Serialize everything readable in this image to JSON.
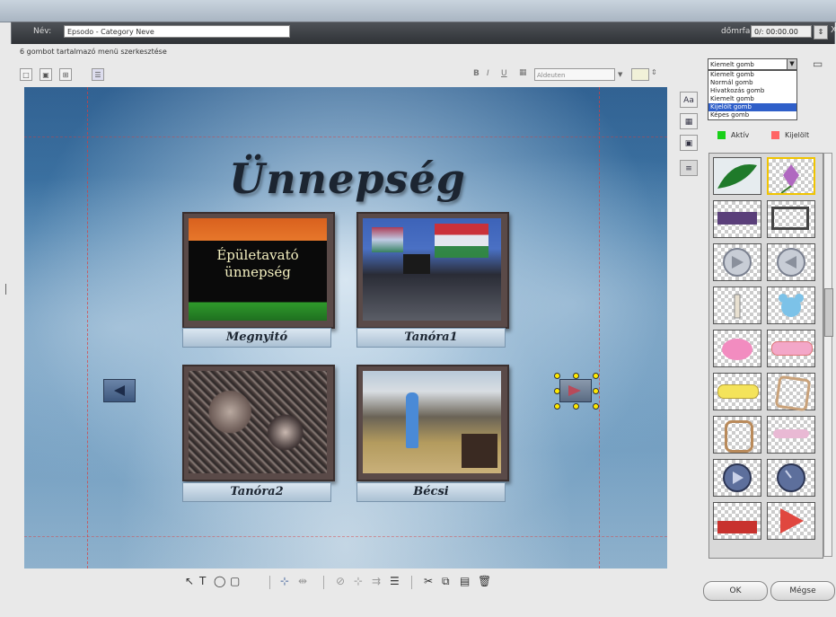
{
  "header": {
    "name_label": "Név:",
    "name_value": "Epsodo - Category Neve",
    "display_label": "dőmrfam",
    "display_value": "0/: 00:00.00",
    "close_glyph": "X"
  },
  "status": "6 gombot tartalmazó menü szerkesztése",
  "toolbar": {
    "font_value": "Aldeuten",
    "bold": "B",
    "italic": "I",
    "underline": "U"
  },
  "canvas": {
    "title": "Ünnepség",
    "thumbs": [
      {
        "caption": "Megnyitó",
        "img_text": "Épületavató ünnepség"
      },
      {
        "caption": "Tanóra1",
        "img_text": ""
      },
      {
        "caption": "Tanóra2",
        "img_text": ""
      },
      {
        "caption": "Bécsi",
        "img_text": ""
      }
    ]
  },
  "bottom_toolbar": {
    "pointer": "↖",
    "text": "T",
    "ellipse": "◯",
    "rect": "▢",
    "align": "⊹",
    "scissors": "✂",
    "copy": "⧉",
    "paste": "▤",
    "trash": "🗑"
  },
  "panel": {
    "dropdown_value": "Kiemelt gomb",
    "dropdown_options": [
      "Kiemelt gomb",
      "Normál gomb",
      "Hivatkozás gomb",
      "Kiemelt gomb",
      "Kijelölt gomb",
      "Képes gomb"
    ],
    "selected_index": 4,
    "legend_active": "Aktív",
    "legend_inactive": "Kijelölt",
    "legend_active_color": "#18d018",
    "legend_inactive_color": "#ff6464",
    "tool_labels": [
      "Aa",
      "▦",
      "▣",
      "≡"
    ]
  },
  "buttons": {
    "ok": "OK",
    "cancel": "Mégse"
  }
}
